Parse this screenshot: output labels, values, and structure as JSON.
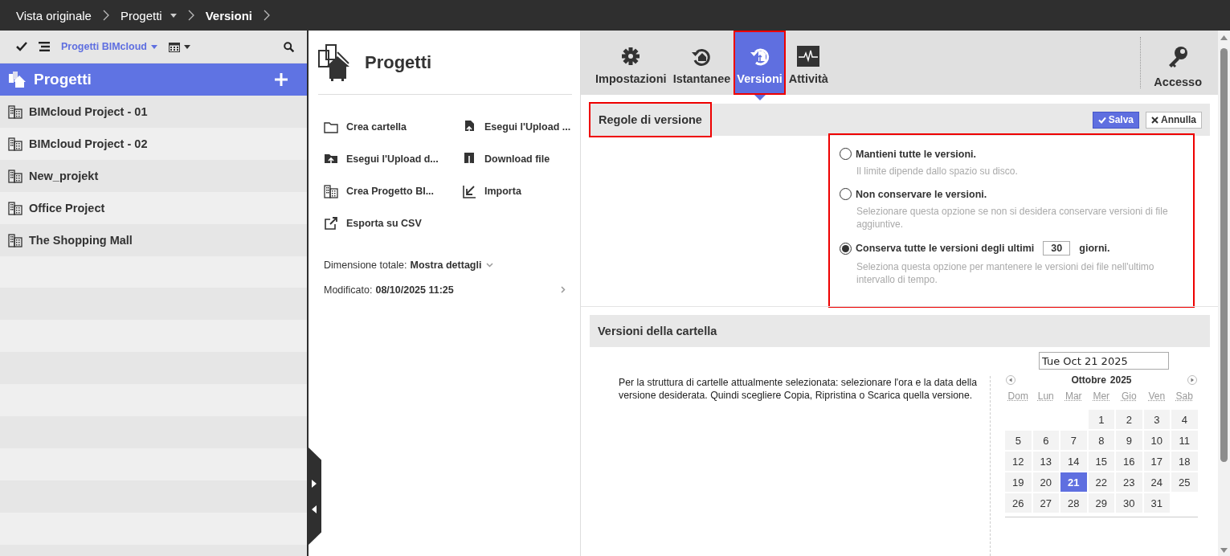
{
  "breadcrumb": [
    {
      "label": "Vista originale",
      "dropdown": false,
      "current": false
    },
    {
      "label": "Progetti",
      "dropdown": true,
      "current": false
    },
    {
      "label": "Versioni",
      "dropdown": false,
      "current": true
    }
  ],
  "sidebar": {
    "filter": "Progetti BIMcloud",
    "header": "Progetti",
    "items": [
      {
        "label": "BIMcloud Project - 01"
      },
      {
        "label": "BIMcloud Project - 02"
      },
      {
        "label": "New_projekt"
      },
      {
        "label": "Office Project"
      },
      {
        "label": "The Shopping Mall"
      }
    ]
  },
  "middle": {
    "title": "Progetti",
    "actions": [
      {
        "label": "Crea cartella",
        "kind": "folder"
      },
      {
        "label": "Esegui l'Upload ...",
        "kind": "upload-file"
      },
      {
        "label": "Esegui l'Upload d...",
        "kind": "upload-folder"
      },
      {
        "label": "Download file",
        "kind": "download"
      },
      {
        "label": "Crea Progetto BI...",
        "kind": "building"
      },
      {
        "label": "Importa",
        "kind": "import"
      },
      {
        "label": "Esporta su CSV",
        "kind": "export"
      }
    ],
    "details": [
      {
        "label": "Dimensione totale:",
        "value": "Mostra dettagli",
        "kind": "dropdown"
      },
      {
        "label": "Modificato:",
        "value": "08/10/2025 11:25",
        "kind": "link"
      }
    ]
  },
  "tabs": [
    {
      "label": "Impostazioni",
      "kind": "settings",
      "selected": false,
      "highlighted": false
    },
    {
      "label": "Istantanee",
      "kind": "snapshot",
      "selected": false,
      "highlighted": false
    },
    {
      "label": "Versioni",
      "kind": "versions",
      "selected": true,
      "highlighted": true
    },
    {
      "label": "Attività",
      "kind": "activity",
      "selected": false,
      "highlighted": false
    }
  ],
  "access": {
    "label": "Accesso"
  },
  "rules": {
    "title": "Regole di versione",
    "highlighted": true,
    "buttons": [
      {
        "label": "Salva",
        "kind": "primary"
      },
      {
        "label": "Annulla",
        "kind": "secondary"
      }
    ],
    "options_highlighted": true,
    "options": [
      {
        "label": "Mantieni tutte le versioni.",
        "hint": "Il limite dipende dallo spazio su disco.",
        "selected": false
      },
      {
        "label": "Non conservare le versioni.",
        "hint": "Selezionare questa opzione se non si desidera conservare versioni di file aggiuntive.",
        "selected": false
      },
      {
        "label": "Conserva tutte le versioni degli ultimi",
        "value": "30",
        "suffix": "giorni.",
        "hint": "Seleziona questa opzione per mantenere le versioni dei file nell'ultimo intervallo di tempo.",
        "selected": true
      }
    ]
  },
  "folder_versions": {
    "title": "Versioni della cartella",
    "text": "Per la struttura di cartelle attualmente selezionata: selezionare l'ora e la data della versione desiderata. Quindi scegliere Copia, Ripristina o Scarica quella versione.",
    "date_field": "Tue Oct 21 2025",
    "calendar": {
      "month": "Ottobre",
      "year": "2025",
      "weekdays": [
        "Dom",
        "Lun",
        "Mar",
        "Mer",
        "Gio",
        "Ven",
        "Sab"
      ],
      "weeks": [
        [
          {
            "kind": "blank"
          },
          {
            "kind": "blank"
          },
          {
            "kind": "blank"
          },
          {
            "day": "1",
            "selected": false
          },
          {
            "day": "2",
            "selected": false
          },
          {
            "day": "3",
            "selected": false
          },
          {
            "day": "4",
            "selected": false
          }
        ],
        [
          {
            "day": "5",
            "selected": false
          },
          {
            "day": "6",
            "selected": false
          },
          {
            "day": "7",
            "selected": false
          },
          {
            "day": "8",
            "selected": false
          },
          {
            "day": "9",
            "selected": false
          },
          {
            "day": "10",
            "selected": false
          },
          {
            "day": "11",
            "selected": false
          }
        ],
        [
          {
            "day": "12",
            "selected": false
          },
          {
            "day": "13",
            "selected": false
          },
          {
            "day": "14",
            "selected": false
          },
          {
            "day": "15",
            "selected": false
          },
          {
            "day": "16",
            "selected": false
          },
          {
            "day": "17",
            "selected": false
          },
          {
            "day": "18",
            "selected": false
          }
        ],
        [
          {
            "day": "19",
            "selected": false
          },
          {
            "day": "20",
            "selected": false
          },
          {
            "day": "21",
            "selected": true
          },
          {
            "day": "22",
            "selected": false
          },
          {
            "day": "23",
            "selected": false
          },
          {
            "day": "24",
            "selected": false
          },
          {
            "day": "25",
            "selected": false
          }
        ],
        [
          {
            "day": "26",
            "selected": false
          },
          {
            "day": "27",
            "selected": false
          },
          {
            "day": "28",
            "selected": false
          },
          {
            "day": "29",
            "selected": false
          },
          {
            "day": "30",
            "selected": false
          },
          {
            "day": "31",
            "selected": false
          },
          {
            "kind": "blank"
          }
        ]
      ]
    }
  }
}
